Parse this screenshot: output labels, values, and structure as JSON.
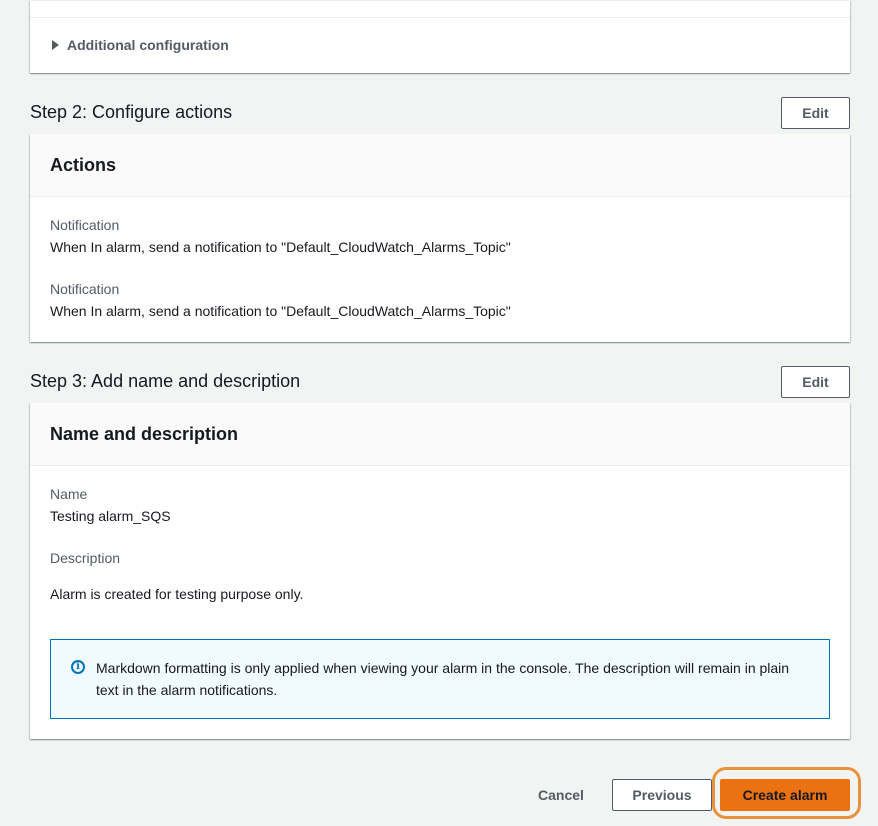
{
  "step1": {
    "additional_configuration": "Additional configuration"
  },
  "step2": {
    "title": "Step 2: Configure actions",
    "edit_label": "Edit",
    "card_title": "Actions",
    "notifications": [
      {
        "label": "Notification",
        "value": "When In alarm, send a notification to \"Default_CloudWatch_Alarms_Topic\""
      },
      {
        "label": "Notification",
        "value": "When In alarm, send a notification to \"Default_CloudWatch_Alarms_Topic\""
      }
    ]
  },
  "step3": {
    "title": "Step 3: Add name and description",
    "edit_label": "Edit",
    "card_title": "Name and description",
    "name_label": "Name",
    "name_value": "Testing alarm_SQS",
    "description_label": "Description",
    "description_value": "Alarm is created for testing purpose only.",
    "info_text": "Markdown formatting is only applied when viewing your alarm in the console. The description will remain in plain text in the alarm notifications."
  },
  "footer": {
    "cancel_label": "Cancel",
    "previous_label": "Previous",
    "create_label": "Create alarm"
  },
  "colors": {
    "primary_button": "#ec7211",
    "focus_ring": "#e8923c",
    "info_border": "#0073bb",
    "info_background": "#f1faff"
  },
  "icons": {
    "expander": "caret-right-icon",
    "info": "info-circle-icon"
  }
}
